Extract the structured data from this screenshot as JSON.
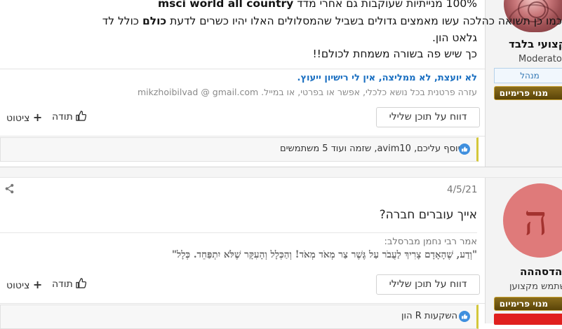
{
  "post1": {
    "body": {
      "line1_prefix": "100% מנייתיות שעוקבות גם אחרי מדד",
      "line1_bold": "msci world all country",
      "line2_a": "כמו כן תשואה כהלכה עשו מאמצים גדולים בשביל שהמסלולים האלו יהיו כשרים לדעת",
      "line2_bold": "כולם",
      "line2_b": "כולל לד",
      "line3": "גלאט הון.",
      "line4": "כך שיש פה בשורה משמחת לכולם!!"
    },
    "signature": {
      "link": "לא יועצת, לא ממליצה, אין לי רישיון ייעוץ.",
      "text": "עזרה פרטנית בכל נושא כלכלי, אפשר או בפרטי, או במייל. mikzhoibilvad @ gmail.com"
    },
    "actions": {
      "report": "דווח על תוכן שלילי",
      "thanks": "תודה",
      "quote": "ציטוט"
    },
    "likes": "יוסף עליכם, avim10, שזמה ועוד 5 משתמשים",
    "author": {
      "name": "קצועי בלבד",
      "role": "Moderator",
      "title_badge": "מנהל",
      "premium_badge": "מנוי פרימיום"
    }
  },
  "post2": {
    "date": "4/5/21",
    "title": "אייך עוברים חברה?",
    "quote": {
      "cite": "אמר רבי נחמן מברסלב:",
      "text": "\"וְדַע, שֶׁהָאָדָם צָרִיךְ לַעֲבֹר עַל גֶּשֶׁר צַר מְאֹד מְאֹד! וְהַכְּלָל וְהָעִקָּר שֶׁלֹּא יִתְפַּחֵד. כְּלָל\""
    },
    "actions": {
      "report": "דווח על תוכן שלילי",
      "thanks": "תודה",
      "quote": "ציטוט"
    },
    "likes": "השקעות R הון",
    "author": {
      "avatar_letter": "ה",
      "name": "הדסההה",
      "role": "שתמש מקצוען",
      "premium_badge": "מנוי פרימיום"
    }
  },
  "colors": {
    "link": "#1a6fc1",
    "avatar_bg": "#df7a7a",
    "premium": "#6b520f",
    "like_icon": "#3f8fde",
    "likes_accent": "#d4c73a"
  },
  "icons": [
    "share-icon",
    "thumbs-up-icon",
    "plus-icon",
    "like-circle-icon"
  ]
}
